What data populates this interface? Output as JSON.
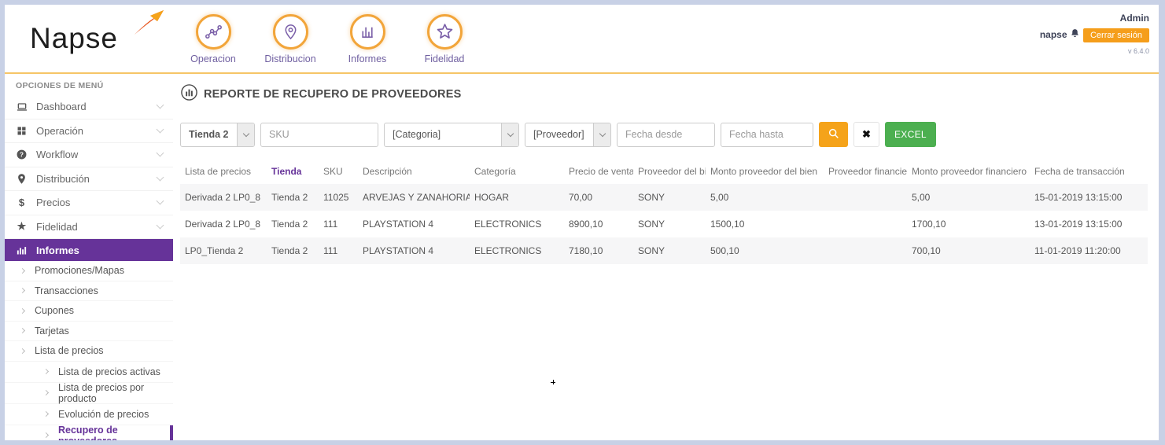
{
  "app": {
    "logo_text": "Napse",
    "version": "v 6.4.0",
    "user": {
      "role": "Admin",
      "name": "napse"
    },
    "logout_label": "Cerrar sesión"
  },
  "top_nav": {
    "items": [
      {
        "label": "Operacion",
        "icon": "line-chart-icon"
      },
      {
        "label": "Distribucion",
        "icon": "location-pin-icon"
      },
      {
        "label": "Informes",
        "icon": "bar-chart-icon"
      },
      {
        "label": "Fidelidad",
        "icon": "star-icon"
      }
    ]
  },
  "sidebar": {
    "header": "OPCIONES DE MENÚ",
    "items": [
      {
        "label": "Dashboard",
        "icon": "laptop-icon"
      },
      {
        "label": "Operación",
        "icon": "grid-icon"
      },
      {
        "label": "Workflow",
        "icon": "question-circle-icon"
      },
      {
        "label": "Distribución",
        "icon": "location-pin-icon"
      },
      {
        "label": "Precios",
        "icon": "dollar-icon",
        "glyph": "$"
      },
      {
        "label": "Fidelidad",
        "icon": "star-icon",
        "glyph": "★"
      },
      {
        "label": "Informes",
        "icon": "bar-chart-icon",
        "active": true
      }
    ],
    "subitems": [
      {
        "label": "Promociones/Mapas"
      },
      {
        "label": "Transacciones"
      },
      {
        "label": "Cupones"
      },
      {
        "label": "Tarjetas"
      },
      {
        "label": "Lista de precios"
      },
      {
        "label": "Lista de precios activas"
      },
      {
        "label": "Lista de precios por producto"
      },
      {
        "label": "Evolución de precios"
      },
      {
        "label": "Recupero de proveedores",
        "active": true
      }
    ]
  },
  "main": {
    "title": "REPORTE DE RECUPERO DE PROVEEDORES",
    "filters": {
      "store_value": "Tienda 2",
      "sku_placeholder": "SKU",
      "category_value": "[Categoria]",
      "provider_value": "[Proveedor]",
      "date_from_placeholder": "Fecha desde",
      "date_to_placeholder": "Fecha hasta",
      "search_icon": "magnifier-icon",
      "clear_label": "✖",
      "excel_label": "EXCEL"
    },
    "table": {
      "columns": [
        "Lista de precios",
        "Tienda",
        "SKU",
        "Descripción",
        "Categoría",
        "Precio de venta",
        "Proveedor del bien",
        "Monto proveedor del bien",
        "Proveedor financiero",
        "Monto proveedor financiero",
        "Fecha de transacción"
      ],
      "sorted_column": "Tienda",
      "rows": [
        [
          "Derivada 2 LP0_8",
          "Tienda 2",
          "11025",
          "ARVEJAS Y ZANAHORIAS",
          "HOGAR",
          "70,00",
          "SONY",
          "5,00",
          "",
          "5,00",
          "15-01-2019 13:15:00"
        ],
        [
          "Derivada 2 LP0_8",
          "Tienda 2",
          "111",
          "PLAYSTATION 4",
          "ELECTRONICS",
          "8900,10",
          "SONY",
          "1500,10",
          "",
          "1700,10",
          "13-01-2019 13:15:00"
        ],
        [
          "LP0_Tienda 2",
          "Tienda 2",
          "111",
          "PLAYSTATION 4",
          "ELECTRONICS",
          "7180,10",
          "SONY",
          "500,10",
          "",
          "700,10",
          "11-01-2019 11:20:00"
        ]
      ]
    }
  },
  "colors": {
    "brand_purple": "#663399",
    "accent_orange": "#F5A31A",
    "excel_green": "#4CAF50",
    "header_underline": "#F6C567",
    "frame_border": "#C8D1E6"
  }
}
